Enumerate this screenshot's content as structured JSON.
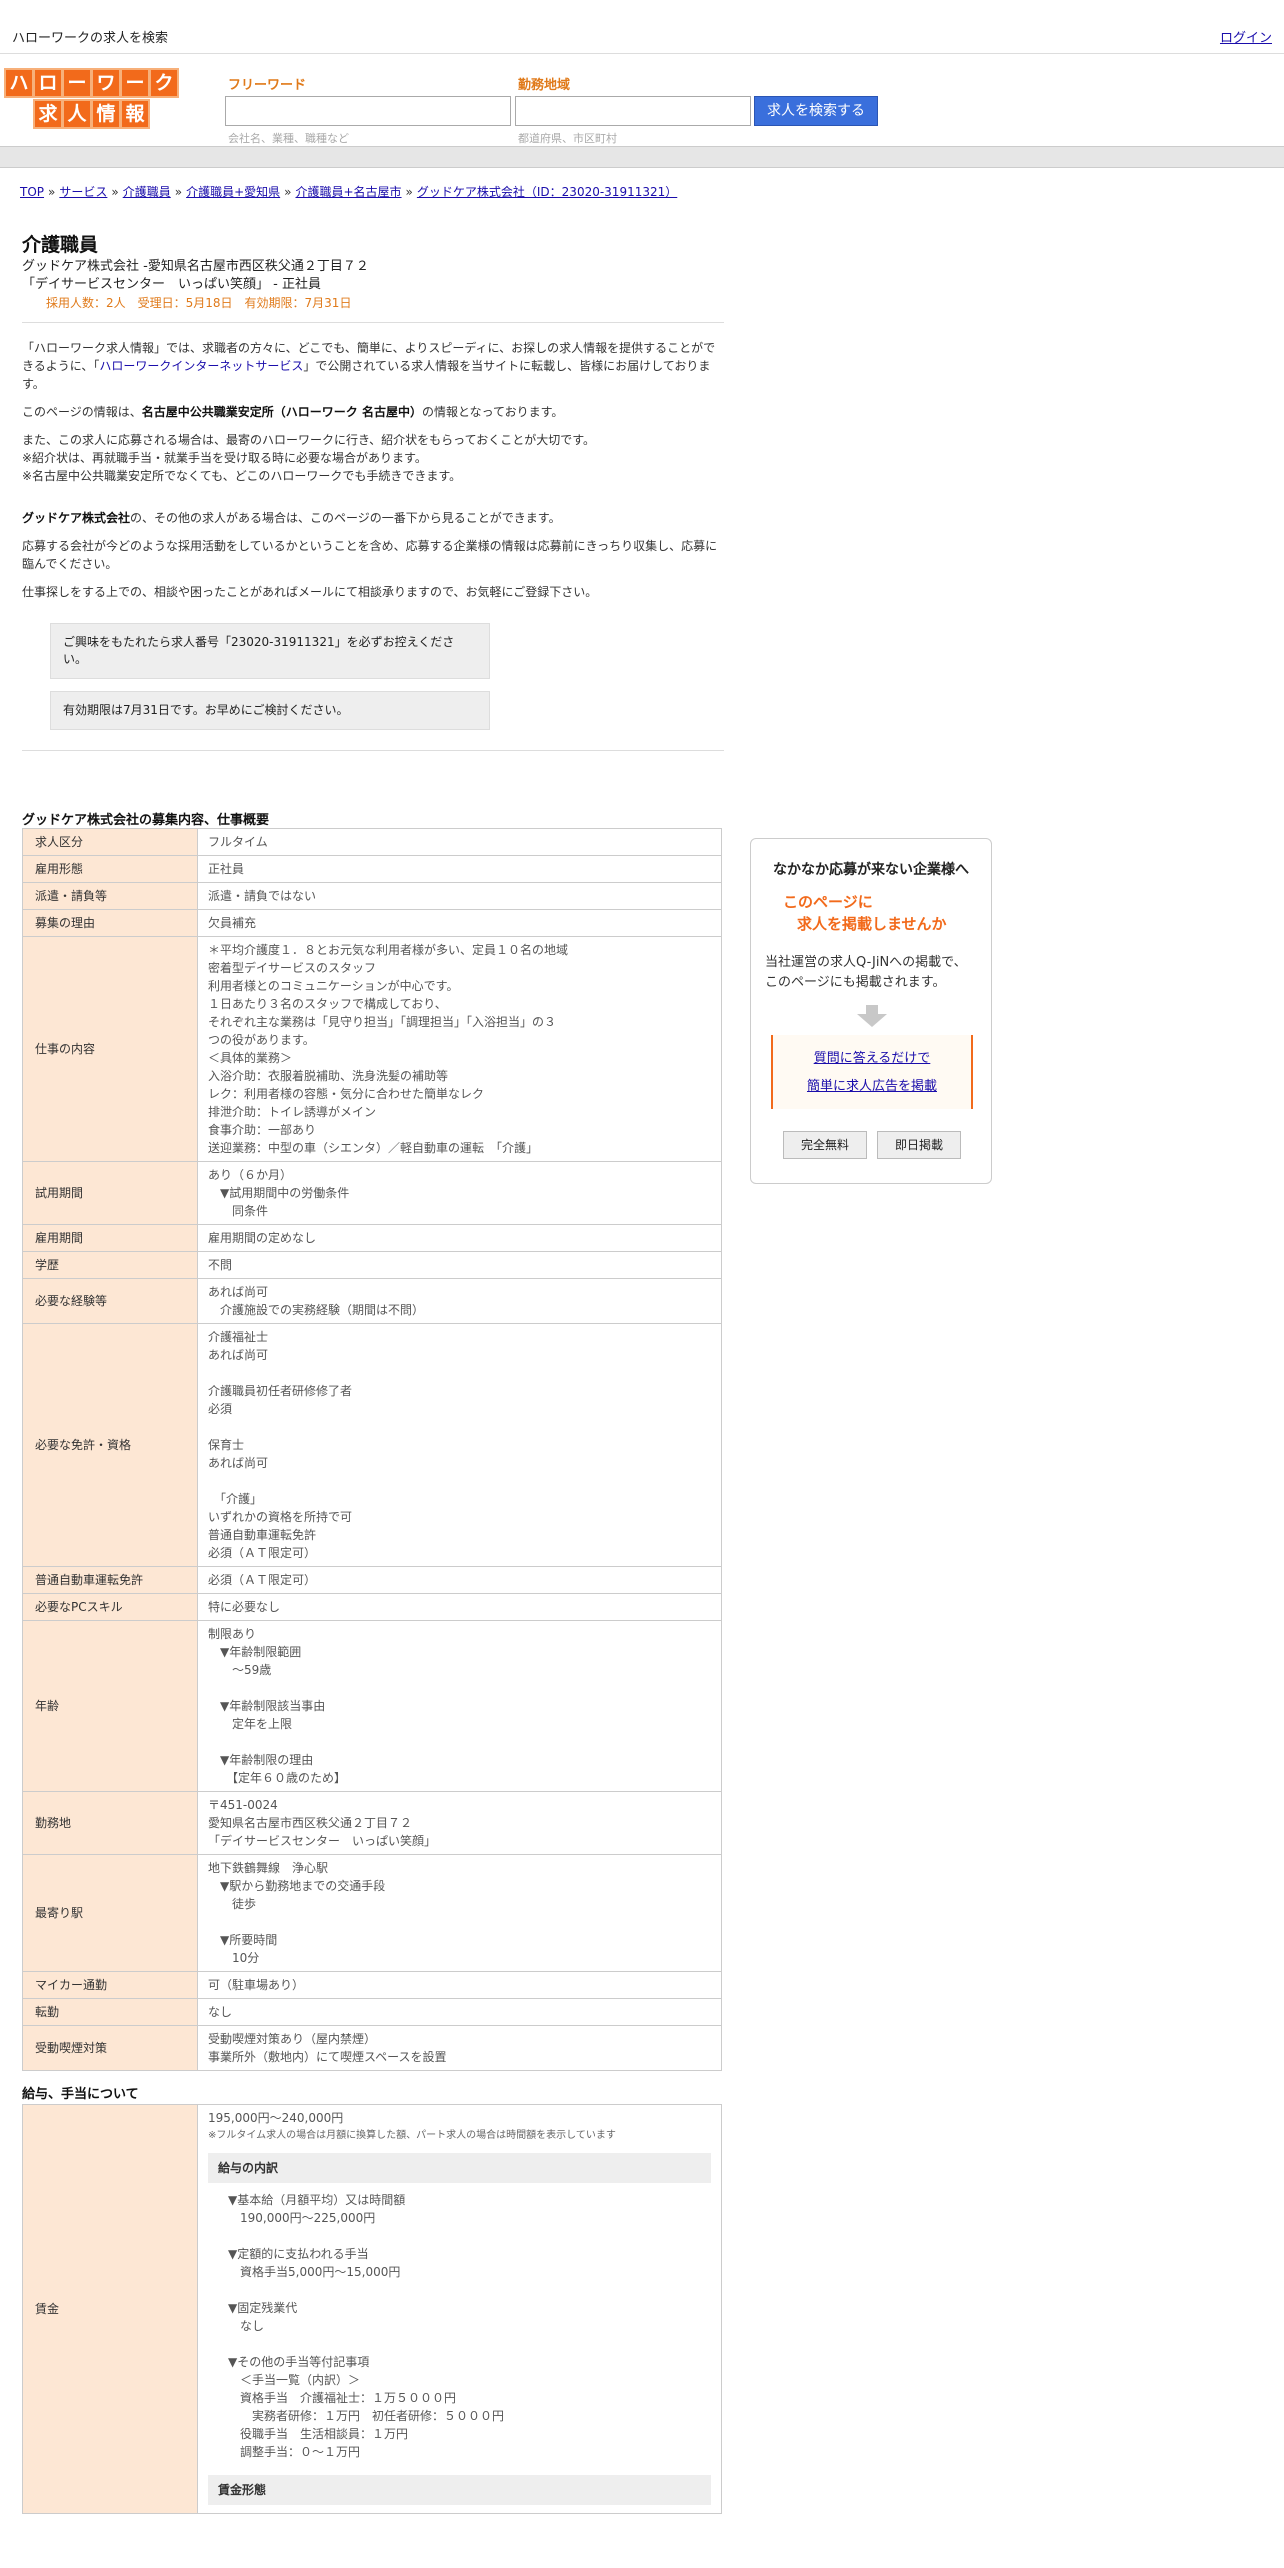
{
  "topbar": {
    "site_title": "ハローワークの求人を検索",
    "login": "ログイン"
  },
  "logo": {
    "top": [
      "ハ",
      "ロ",
      "ー",
      "ワ",
      "ー",
      "ク"
    ],
    "bottom": [
      "求",
      "人",
      "情",
      "報"
    ]
  },
  "search": {
    "keyword_label": "フリーワード",
    "keyword_hint": "会社名、業種、職種など",
    "area_label": "勤務地域",
    "area_hint": "都道府県、市区町村",
    "button": "求人を検索する"
  },
  "breadcrumb": [
    "TOP",
    "サービス",
    "介護職員",
    "介護職員+愛知県",
    "介護職員+名古屋市",
    "グッドケア株式会社（ID：23020-31911321）"
  ],
  "job": {
    "title": "介護職員",
    "company_line": "グッドケア株式会社 -愛知県名古屋市西区秩父通２丁目７２",
    "facility_line": "「デイサービスセンター　いっぱい笑顔」 - 正社員",
    "meta": "採用人数：2人　受理日：5月18日　有効期限：7月31日"
  },
  "intro": {
    "p1a": "「ハローワーク求人情報」では、求職者の方々に、どこでも、簡単に、よりスピーディに、お探しの求人情報を提供することができるように、「",
    "p1_link": "ハローワークインターネットサービス",
    "p1b": "」で公開されている求人情報を当サイトに転載し、皆様にお届けしております。",
    "p2a": "このページの情報は、",
    "p2_bold": "名古屋中公共職業安定所（ハローワーク 名古屋中）",
    "p2b": "の情報となっております。",
    "p3": "また、この求人に応募される場合は、最寄のハローワークに行き、紹介状をもらっておくことが大切です。",
    "p3b": "※紹介状は、再就職手当・就業手当を受け取る時に必要な場合があります。",
    "p3c": "※名古屋中公共職業安定所でなくても、どこのハローワークでも手続きできます。",
    "p4_bold": "グッドケア株式会社",
    "p4": "の、その他の求人がある場合は、このページの一番下から見ることができます。",
    "p5": "応募する会社が今どのような採用活動をしているかということを含め、応募する企業様の情報は応募前にきっちり収集し、応募に臨んでください。",
    "p6": "仕事探しをする上での、相談や困ったことがあればメールにて相談承りますので、お気軽にご登録下さい。",
    "notice1": "ご興味をもたれたら求人番号「23020-31911321」を必ずお控えください。",
    "notice2": "有効期限は7月31日です。お早めにご検討ください。"
  },
  "details": {
    "title": "グッドケア株式会社の募集内容、仕事概要",
    "rows": [
      {
        "k": "求人区分",
        "v": "フルタイム"
      },
      {
        "k": "雇用形態",
        "v": "正社員"
      },
      {
        "k": "派遣・請負等",
        "v": "派遣・請負ではない"
      },
      {
        "k": "募集の理由",
        "v": "欠員補充"
      },
      {
        "k": "仕事の内容",
        "v": "＊平均介護度１．８とお元気な利用者様が多い、定員１０名の地域\n密着型デイサービスのスタッフ\n利用者様とのコミュニケーションが中心です。\n１日あたり３名のスタッフで構成しており、\nそれぞれ主な業務は「見守り担当」「調理担当」「入浴担当」の３\nつの役があります。\n＜具体的業務＞\n入浴介助：衣服着脱補助、洗身洗髪の補助等\nレク：利用者様の容態・気分に合わせた簡単なレク\n排泄介助：トイレ誘導がメイン\n食事介助：一部あり\n送迎業務：中型の車（シエンタ）／軽自動車の運転　「介護」"
      },
      {
        "k": "試用期間",
        "v": "あり（６か月）\n　▼試用期間中の労働条件\n　　同条件"
      },
      {
        "k": "雇用期間",
        "v": "雇用期間の定めなし"
      },
      {
        "k": "学歴",
        "v": "不問"
      },
      {
        "k": "必要な経験等",
        "v": "あれば尚可\n　介護施設での実務経験（期間は不問）"
      },
      {
        "k": "必要な免許・資格",
        "v": "介護福祉士\nあれば尚可\n\n介護職員初任者研修修了者\n必須\n\n保育士\nあれば尚可\n\n　「介護」\nいずれかの資格を所持で可\n普通自動車運転免許\n必須（ＡＴ限定可）"
      },
      {
        "k": "普通自動車運転免許",
        "v": "必須（ＡＴ限定可）"
      },
      {
        "k": "必要なPCスキル",
        "v": "特に必要なし"
      },
      {
        "k": "年齢",
        "v": "制限あり\n　▼年齢制限範囲\n　　〜59歳\n\n　▼年齢制限該当事由\n　　定年を上限\n\n　▼年齢制限の理由\n　　【定年６０歳のため】"
      },
      {
        "k": "勤務地",
        "v": "〒451-0024\n愛知県名古屋市西区秩父通２丁目７２\n「デイサービスセンター　いっぱい笑顔」"
      },
      {
        "k": "最寄り駅",
        "v": "地下鉄鶴舞線　浄心駅\n　▼駅から勤務地までの交通手段\n　　徒歩\n\n　▼所要時間\n　　10分"
      },
      {
        "k": "マイカー通勤",
        "v": "可（駐車場あり）"
      },
      {
        "k": "転勤",
        "v": "なし"
      },
      {
        "k": "受動喫煙対策",
        "v": "受動喫煙対策あり（屋内禁煙）\n事業所外（敷地内）にて喫煙スペースを設置"
      }
    ]
  },
  "salary": {
    "title": "給与、手当について",
    "label": "賃金",
    "range": "195,000円〜240,000円",
    "note": "※フルタイム求人の場合は月額に換算した額、パート求人の場合は時間額を表示しています",
    "breakdown_title": "給与の内訳",
    "breakdown": "▼基本給（月額平均）又は時間額\n　190,000円〜225,000円\n\n▼定額的に支払われる手当\n　資格手当5,000円〜15,000円\n\n▼固定残業代\n　なし\n\n▼その他の手当等付記事項\n　＜手当一覧（内訳）＞\n　資格手当　介護福祉士：１万５０００円\n　　実務者研修：１万円　初任者研修：５０００円\n　役職手当　生活相談員：１万円\n　調整手当：０～１万円",
    "form_title": "賃金形態"
  },
  "side": {
    "title": "なかなか応募が来ない企業様へ",
    "red1": "このページに",
    "red2": "求人を掲載しませんか",
    "desc1": "当社運営の求人Q-JiNへの掲載で、",
    "desc2": "このページにも掲載されます。",
    "link1": "質問に答えるだけで",
    "link2": "簡単に求人広告を掲載",
    "btn1": "完全無料",
    "btn2": "即日掲載"
  }
}
